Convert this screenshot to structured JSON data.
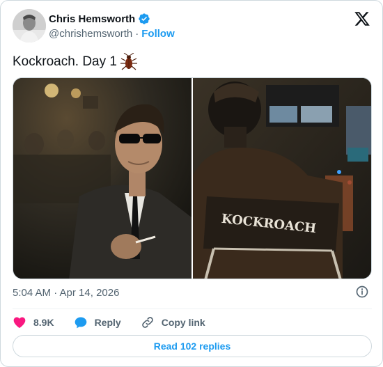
{
  "author": {
    "name": "Chris Hemsworth",
    "handle": "@chrishemsworth",
    "separator": "·",
    "follow_label": "Follow",
    "verified": true
  },
  "tweet": {
    "text": "Kockroach. Day 1",
    "emoji_icon": "cockroach-icon",
    "timestamp": "5:04 AM · Apr 14, 2026",
    "images": [
      {
        "description_icon": "photo-man-in-sunglasses-smoking"
      },
      {
        "description_icon": "photo-director-chair-kockroach"
      }
    ],
    "chair_text": "KOCKROACH"
  },
  "actions": {
    "like_count": "8.9K",
    "reply_label": "Reply",
    "copy_link_label": "Copy link"
  },
  "replies_button": "Read 102 replies",
  "colors": {
    "accent": "#1d9bf0",
    "like": "#f91880",
    "text_secondary": "#536471"
  }
}
